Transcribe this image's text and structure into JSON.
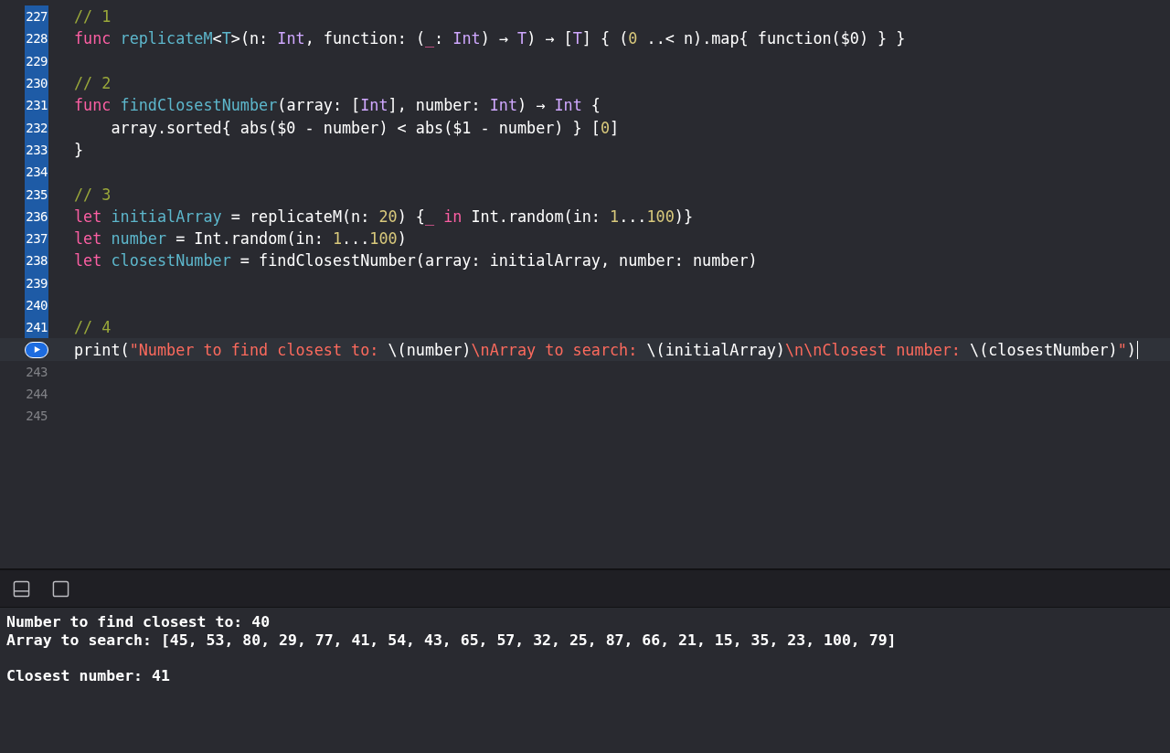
{
  "editor": {
    "lines": [
      {
        "number": "227",
        "executed": true,
        "tokens": [
          {
            "kind": "comment",
            "text": "// 1"
          }
        ]
      },
      {
        "number": "228",
        "executed": true,
        "tokens": [
          {
            "kind": "keyword",
            "text": "func "
          },
          {
            "kind": "decl",
            "text": "replicateM"
          },
          {
            "kind": "plain",
            "text": "<"
          },
          {
            "kind": "decl",
            "text": "T"
          },
          {
            "kind": "plain",
            "text": ">(n: "
          },
          {
            "kind": "type",
            "text": "Int"
          },
          {
            "kind": "plain",
            "text": ", function: ("
          },
          {
            "kind": "keyword",
            "text": "_"
          },
          {
            "kind": "plain",
            "text": ": "
          },
          {
            "kind": "type",
            "text": "Int"
          },
          {
            "kind": "plain",
            "text": ") → "
          },
          {
            "kind": "type",
            "text": "T"
          },
          {
            "kind": "plain",
            "text": ") → ["
          },
          {
            "kind": "type",
            "text": "T"
          },
          {
            "kind": "plain",
            "text": "] { ("
          },
          {
            "kind": "number",
            "text": "0"
          },
          {
            "kind": "plain",
            "text": " ..< n).map{ function($0) } }"
          }
        ]
      },
      {
        "number": "229",
        "executed": true
      },
      {
        "number": "230",
        "executed": true,
        "tokens": [
          {
            "kind": "comment",
            "text": "// 2"
          }
        ]
      },
      {
        "number": "231",
        "executed": true,
        "tokens": [
          {
            "kind": "keyword",
            "text": "func "
          },
          {
            "kind": "decl",
            "text": "findClosestNumber"
          },
          {
            "kind": "plain",
            "text": "(array: ["
          },
          {
            "kind": "type",
            "text": "Int"
          },
          {
            "kind": "plain",
            "text": "], number: "
          },
          {
            "kind": "type",
            "text": "Int"
          },
          {
            "kind": "plain",
            "text": ") → "
          },
          {
            "kind": "type",
            "text": "Int"
          },
          {
            "kind": "plain",
            "text": " {"
          }
        ]
      },
      {
        "number": "232",
        "executed": true,
        "tokens": [
          {
            "kind": "plain",
            "text": "    array.sorted{ abs($0 - number) < abs($1 - number) } ["
          },
          {
            "kind": "number",
            "text": "0"
          },
          {
            "kind": "plain",
            "text": "]"
          }
        ]
      },
      {
        "number": "233",
        "executed": true,
        "tokens": [
          {
            "kind": "plain",
            "text": "}"
          }
        ]
      },
      {
        "number": "234",
        "executed": true
      },
      {
        "number": "235",
        "executed": true,
        "tokens": [
          {
            "kind": "comment",
            "text": "// 3"
          }
        ]
      },
      {
        "number": "236",
        "executed": true,
        "tokens": [
          {
            "kind": "keyword",
            "text": "let "
          },
          {
            "kind": "decl",
            "text": "initialArray"
          },
          {
            "kind": "plain",
            "text": " = replicateM(n: "
          },
          {
            "kind": "number",
            "text": "20"
          },
          {
            "kind": "plain",
            "text": ") {"
          },
          {
            "kind": "keyword",
            "text": "_ in"
          },
          {
            "kind": "plain",
            "text": " Int.random(in: "
          },
          {
            "kind": "number",
            "text": "1"
          },
          {
            "kind": "plain",
            "text": "..."
          },
          {
            "kind": "number",
            "text": "100"
          },
          {
            "kind": "plain",
            "text": ")}"
          }
        ]
      },
      {
        "number": "237",
        "executed": true,
        "tokens": [
          {
            "kind": "keyword",
            "text": "let "
          },
          {
            "kind": "decl",
            "text": "number"
          },
          {
            "kind": "plain",
            "text": " = Int.random(in: "
          },
          {
            "kind": "number",
            "text": "1"
          },
          {
            "kind": "plain",
            "text": "..."
          },
          {
            "kind": "number",
            "text": "100"
          },
          {
            "kind": "plain",
            "text": ")"
          }
        ]
      },
      {
        "number": "238",
        "executed": true,
        "tokens": [
          {
            "kind": "keyword",
            "text": "let "
          },
          {
            "kind": "decl",
            "text": "closestNumber"
          },
          {
            "kind": "plain",
            "text": " = findClosestNumber(array: initialArray, number: number)"
          }
        ]
      },
      {
        "number": "239",
        "executed": true
      },
      {
        "number": "240",
        "executed": true
      },
      {
        "number": "241",
        "executed": true,
        "tokens": [
          {
            "kind": "comment",
            "text": "// 4"
          }
        ]
      },
      {
        "run_button": true,
        "current": true,
        "tokens": [
          {
            "kind": "plain",
            "text": "print("
          },
          {
            "kind": "string",
            "text": "\"Number to find closest to: "
          },
          {
            "kind": "plain",
            "text": "\\(number)"
          },
          {
            "kind": "string",
            "text": "\\nArray to search: "
          },
          {
            "kind": "plain",
            "text": "\\(initialArray)"
          },
          {
            "kind": "string",
            "text": "\\n\\nClosest number: "
          },
          {
            "kind": "plain",
            "text": "\\(closestNumber)"
          },
          {
            "kind": "string",
            "text": "\""
          },
          {
            "kind": "plain",
            "text": ")"
          }
        ]
      },
      {
        "number": "243",
        "executed": false
      },
      {
        "number": "244",
        "executed": false
      },
      {
        "number": "245",
        "executed": false
      }
    ]
  },
  "console": {
    "output": "Number to find closest to: 40\nArray to search: [45, 53, 80, 29, 77, 41, 54, 43, 65, 57, 32, 25, 87, 66, 21, 15, 35, 23, 100, 79]\n\nClosest number: 41"
  }
}
